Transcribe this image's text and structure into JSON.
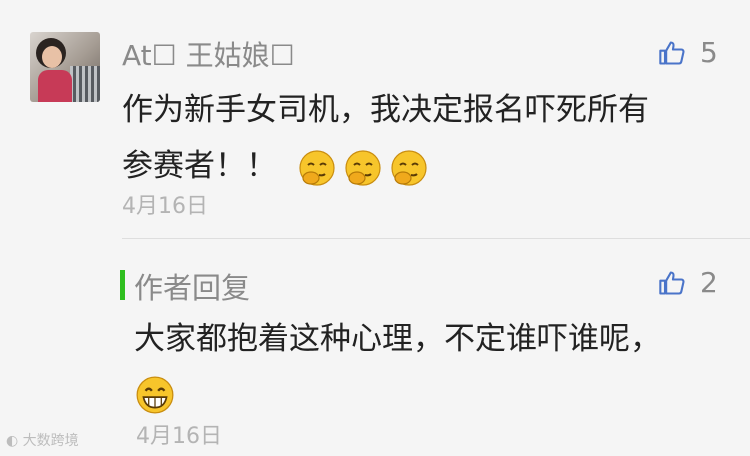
{
  "comment": {
    "author": "At☐ 王姑娘☐",
    "likes": "5",
    "line1": "作为新手女司机，我决定报名吓死所有",
    "line2": "参赛者！！",
    "emojis": [
      "thinking-face-emoji",
      "thinking-face-emoji",
      "thinking-face-emoji"
    ],
    "date": "4月16日"
  },
  "reply": {
    "label": "作者回复",
    "likes": "2",
    "line1": "大家都抱着这种心理，不定谁吓谁呢，",
    "emojis": [
      "grinning-face-emoji"
    ],
    "date": "4月16日"
  },
  "watermark": "大数跨境",
  "colors": {
    "reply_accent": "#2fbf1f",
    "like_icon": "#4a74c9",
    "meta_text": "#8a8a8a"
  }
}
